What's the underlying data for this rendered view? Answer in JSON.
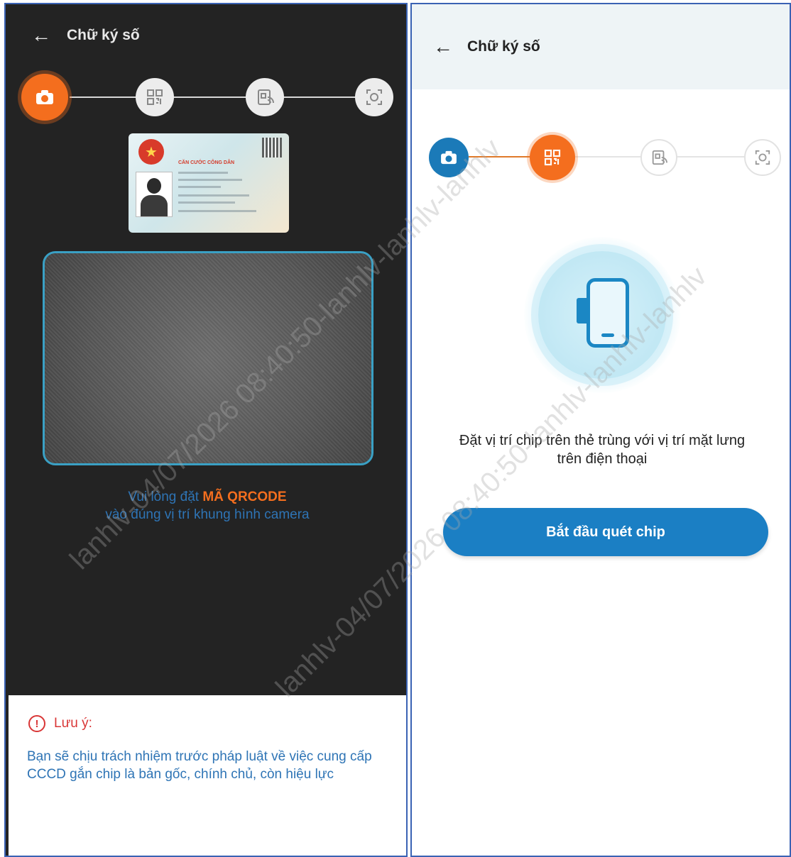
{
  "left": {
    "header": {
      "title": "Chữ ký số"
    },
    "card": {
      "title": "CĂN CƯỚC CÔNG DÂN"
    },
    "instruction": {
      "prefix": "Vui lòng đặt",
      "highlight": "MÃ QRCODE",
      "line2": "vào đúng vị trí khung hình camera"
    },
    "note": {
      "title": "Lưu ý:",
      "body": "Bạn sẽ chịu trách nhiệm trước pháp luật về việc cung cấp CCCD gắn chip là bản gốc, chính chủ, còn hiệu lực"
    }
  },
  "right": {
    "header": {
      "title": "Chữ ký số"
    },
    "place_text": {
      "line1": "Đặt vị trí chip trên thẻ trùng với vị trí mặt lưng",
      "line2": "trên điện thoại"
    },
    "button": {
      "label": "Bắt đầu quét chip"
    }
  },
  "watermark": "lanhlv-04/07/2026 08:40:50-lanhlv-lanhlv-lanhlv",
  "colors": {
    "accent_orange": "#f46e1e",
    "primary_blue": "#1b7fc4",
    "text_blue": "#2e74b5",
    "warning_red": "#d93636",
    "dark_bg": "#232323"
  },
  "icons": {
    "steps": [
      "camera-icon",
      "qr-code-icon",
      "nfc-card-icon",
      "face-scan-icon"
    ],
    "back": "arrow-left-icon",
    "warning": "exclamation-circle-icon",
    "phone": "phone-chip-icon"
  }
}
